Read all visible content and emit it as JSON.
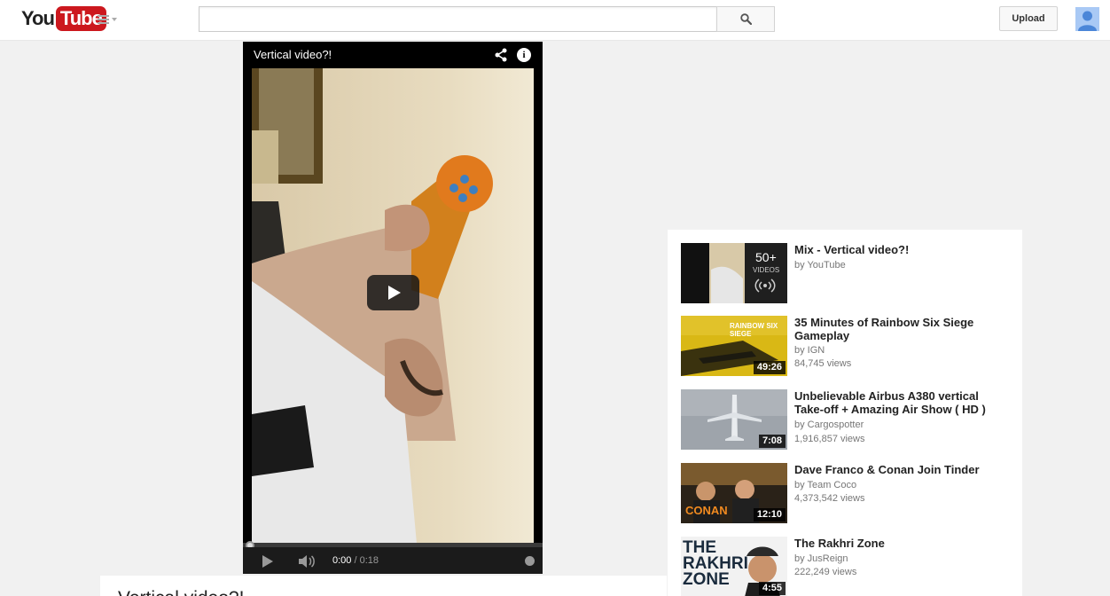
{
  "masthead": {
    "logo_you": "You",
    "logo_tube": "Tube",
    "search_placeholder": "",
    "upload_label": "Upload"
  },
  "player": {
    "title": "Vertical video?!",
    "time_current": "0:00",
    "time_separator": " / ",
    "time_total": "0:18",
    "progress": 0
  },
  "sidebar": {
    "items": [
      {
        "title": "Mix - Vertical video?!",
        "channel": "by YouTube",
        "views": "",
        "duration": "",
        "playlist_count": "50+",
        "playlist_label": "VIDEOS"
      },
      {
        "title": "35 Minutes of Rainbow Six Siege Gameplay",
        "channel": "by IGN",
        "views": "84,745 views",
        "duration": "49:26",
        "thumb_text": "RAINBOW SIX SIEGE"
      },
      {
        "title": "Unbelievable Airbus A380 vertical Take-off + Amazing Air Show ( HD )",
        "channel": "by Cargospotter",
        "views": "1,916,857 views",
        "duration": "7:08"
      },
      {
        "title": "Dave Franco & Conan Join Tinder",
        "channel": "by Team Coco",
        "views": "4,373,542 views",
        "duration": "12:10",
        "thumb_text": "CONAN"
      },
      {
        "title": "The Rakhri Zone",
        "channel": "by JusReign",
        "views": "222,249 views",
        "duration": "4:55",
        "thumb_text": "THE RAKHRI ZONE"
      }
    ]
  },
  "info": {
    "title": "Vertical video?!"
  },
  "colors": {
    "brand_red": "#cc181e",
    "page_bg": "#f1f1f1"
  }
}
